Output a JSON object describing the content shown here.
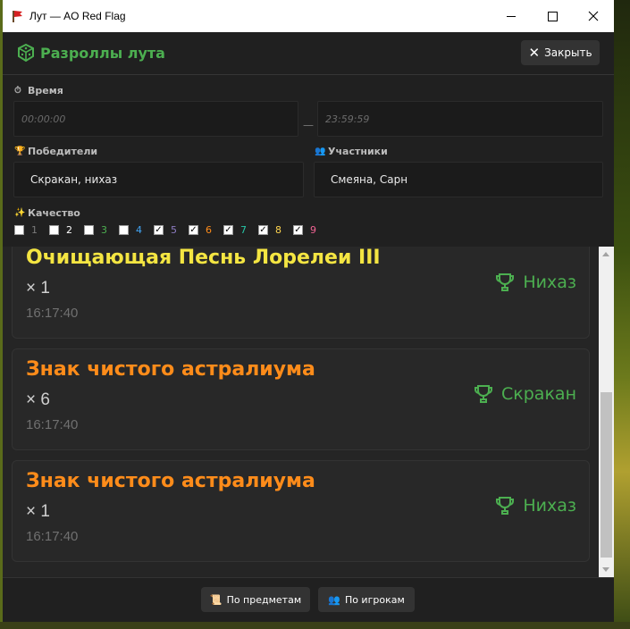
{
  "window": {
    "title": "Лут — AO Red Flag"
  },
  "header": {
    "title": "Разроллы лута",
    "close_label": "Закрыть"
  },
  "filters": {
    "time_label": "Время",
    "time_from_placeholder": "00:00:00",
    "time_to_placeholder": "23:59:59",
    "time_separator": "—",
    "winners_label": "Победители",
    "winners_value": "Скракан, нихаз",
    "participants_label": "Участники",
    "participants_value": "Смеяна, Сарн",
    "quality_label": "Качество",
    "quality": [
      {
        "label": "1",
        "checked": false,
        "color": "#7a7a7a"
      },
      {
        "label": "2",
        "checked": false,
        "color": "#ffffff"
      },
      {
        "label": "3",
        "checked": false,
        "color": "#4caf50"
      },
      {
        "label": "4",
        "checked": false,
        "color": "#42a5f5"
      },
      {
        "label": "5",
        "checked": true,
        "color": "#8e7cc3"
      },
      {
        "label": "6",
        "checked": true,
        "color": "#ff8c1a"
      },
      {
        "label": "7",
        "checked": true,
        "color": "#26c6a6"
      },
      {
        "label": "8",
        "checked": true,
        "color": "#ffd54f"
      },
      {
        "label": "9",
        "checked": true,
        "color": "#f06292"
      }
    ]
  },
  "loot": [
    {
      "name": "Очищающая Песнь Лорелеи III",
      "qty": "× 1",
      "time": "16:17:40",
      "winner": "Нихаз",
      "color": "#f4e542"
    },
    {
      "name": "Знак чистого астралиума",
      "qty": "× 6",
      "time": "16:17:40",
      "winner": "Скракан",
      "color": "#ff8c1a"
    },
    {
      "name": "Знак чистого астралиума",
      "qty": "× 1",
      "time": "16:17:40",
      "winner": "Нихаз",
      "color": "#ff8c1a"
    }
  ],
  "footer": {
    "by_items": "По предметам",
    "by_players": "По игрокам"
  },
  "colors": {
    "accent": "#4caf50",
    "background": "#202020"
  }
}
